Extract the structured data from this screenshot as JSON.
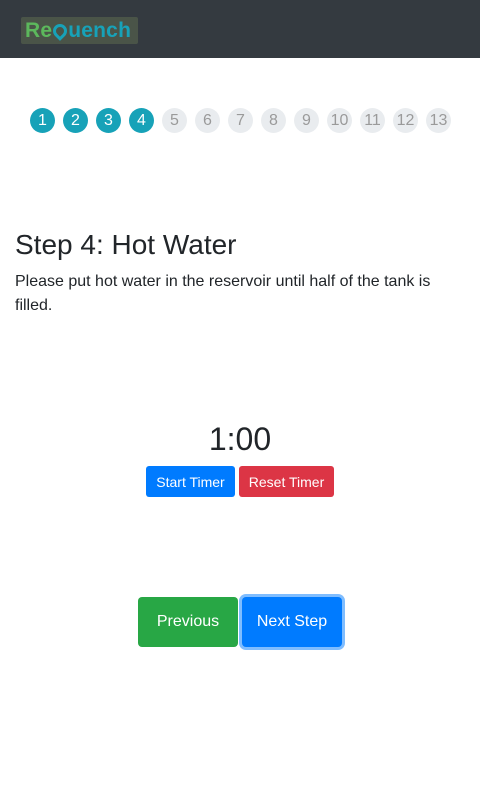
{
  "app": {
    "logo_alt": "ReQuench",
    "logo_parts": [
      "Re",
      "uench"
    ]
  },
  "progress": {
    "steps": [
      "1",
      "2",
      "3",
      "4",
      "5",
      "6",
      "7",
      "8",
      "9",
      "10",
      "11",
      "12",
      "13"
    ],
    "current_step": 4
  },
  "step": {
    "title": "Step 4: Hot Water",
    "description": "Please put hot water in the reservoir until half of the tank is filled."
  },
  "timer": {
    "value": "1:00",
    "start_label": "Start Timer",
    "reset_label": "Reset Timer"
  },
  "navigation": {
    "previous_label": "Previous",
    "next_label": "Next Step"
  },
  "colors": {
    "navbar": "#343a40",
    "step_done": "#17a2b8",
    "primary": "#007bff",
    "danger": "#dc3545",
    "success": "#28a745"
  }
}
